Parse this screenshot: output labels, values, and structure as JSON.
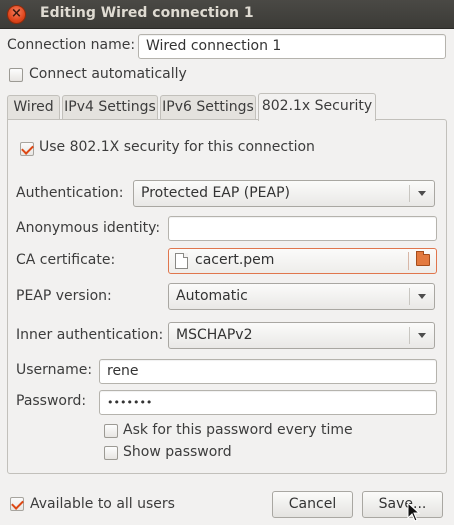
{
  "window": {
    "title": "Editing Wired connection 1",
    "close_glyph": "×"
  },
  "connection_name": {
    "label": "Connection name:",
    "value": "Wired connection 1"
  },
  "connect_automatically": {
    "label": "Connect automatically",
    "checked": false
  },
  "tabs": [
    {
      "label": "Wired",
      "active": false
    },
    {
      "label": "IPv4 Settings",
      "active": false
    },
    {
      "label": "IPv6 Settings",
      "active": false
    },
    {
      "label": "802.1x Security",
      "active": true
    }
  ],
  "security": {
    "use_8021x": {
      "label": "Use 802.1X security for this connection",
      "checked": true
    },
    "authentication": {
      "label": "Authentication:",
      "value": "Protected EAP (PEAP)"
    },
    "anonymous_identity": {
      "label": "Anonymous identity:",
      "value": ""
    },
    "ca_certificate": {
      "label": "CA certificate:",
      "value": "cacert.pem"
    },
    "peap_version": {
      "label": "PEAP version:",
      "value": "Automatic"
    },
    "inner_authentication": {
      "label": "Inner authentication:",
      "value": "MSCHAPv2"
    },
    "username": {
      "label": "Username:",
      "value": "rene"
    },
    "password": {
      "label": "Password:",
      "value": "•••••••"
    },
    "ask_password": {
      "label": "Ask for this password every time",
      "checked": false
    },
    "show_password": {
      "label": "Show password",
      "checked": false
    }
  },
  "available_to_all": {
    "label": "Available to all users",
    "checked": true
  },
  "buttons": {
    "cancel": "Cancel",
    "save": "Save..."
  },
  "colors": {
    "accent": "#dd4814",
    "titlebar": "#3c3b37",
    "background": "#f2f1f0"
  },
  "icons": [
    "close-icon",
    "document-icon",
    "folder-icon",
    "dropdown-arrow-icon",
    "mouse-pointer-icon"
  ]
}
